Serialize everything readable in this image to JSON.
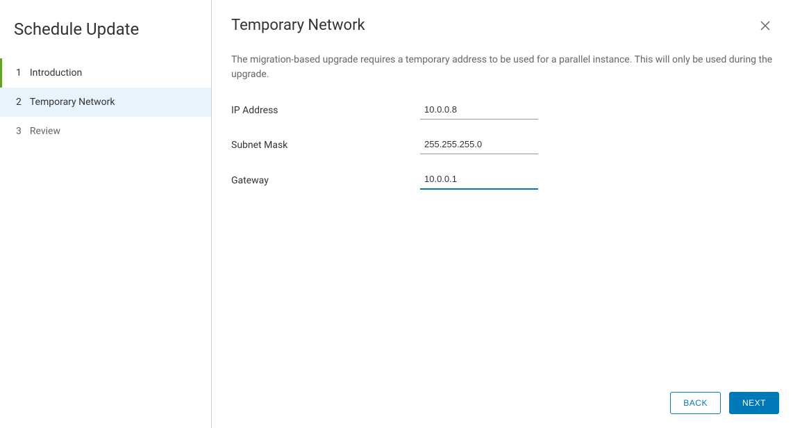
{
  "sidebar": {
    "title": "Schedule Update",
    "steps": [
      {
        "number": "1",
        "label": "Introduction"
      },
      {
        "number": "2",
        "label": "Temporary Network"
      },
      {
        "number": "3",
        "label": "Review"
      }
    ]
  },
  "main": {
    "title": "Temporary Network",
    "description": "The migration-based upgrade requires a temporary address to be used for a parallel instance. This will only be used during the upgrade.",
    "fields": {
      "ip_address": {
        "label": "IP Address",
        "value": "10.0.0.8"
      },
      "subnet_mask": {
        "label": "Subnet Mask",
        "value": "255.255.255.0"
      },
      "gateway": {
        "label": "Gateway",
        "value": "10.0.0.1"
      }
    }
  },
  "footer": {
    "back_label": "Back",
    "next_label": "Next"
  }
}
